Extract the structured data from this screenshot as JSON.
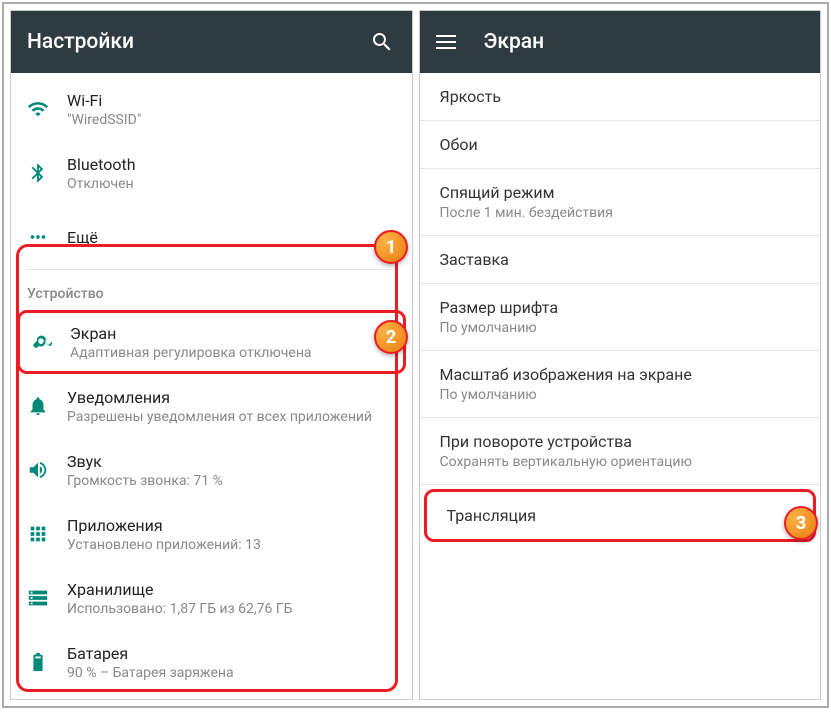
{
  "left": {
    "title": "Настройки",
    "items": {
      "wifi": {
        "title": "Wi-Fi",
        "sub": "\"WiredSSID\""
      },
      "bluetooth": {
        "title": "Bluetooth",
        "sub": "Отключен"
      },
      "more": {
        "title": "Ещё"
      }
    },
    "sectionDevice": "Устройство",
    "device": {
      "display": {
        "title": "Экран",
        "sub": "Адаптивная регулировка отключена"
      },
      "notifications": {
        "title": "Уведомления",
        "sub": "Разрешены уведомления от всех приложений"
      },
      "sound": {
        "title": "Звук",
        "sub": "Громкость звонка: 71 %"
      },
      "apps": {
        "title": "Приложения",
        "sub": "Установлено приложений: 13"
      },
      "storage": {
        "title": "Хранилище",
        "sub": "Использовано: 1,87 ГБ из 62,76 ГБ"
      },
      "battery": {
        "title": "Батарея",
        "sub": "90 % – Батарея заряжена"
      }
    }
  },
  "right": {
    "title": "Экран",
    "items": {
      "brightness": {
        "title": "Яркость"
      },
      "wallpaper": {
        "title": "Обои"
      },
      "sleep": {
        "title": "Спящий режим",
        "sub": "После 1 мин. бездействия"
      },
      "screensaver": {
        "title": "Заставка"
      },
      "fontsize": {
        "title": "Размер шрифта",
        "sub": "По умолчанию"
      },
      "displaysize": {
        "title": "Масштаб изображения на экране",
        "sub": "По умолчанию"
      },
      "rotate": {
        "title": "При повороте устройства",
        "sub": "Сохранять вертикальную ориентацию"
      },
      "cast": {
        "title": "Трансляция"
      }
    }
  },
  "badges": {
    "b1": "1",
    "b2": "2",
    "b3": "3"
  }
}
